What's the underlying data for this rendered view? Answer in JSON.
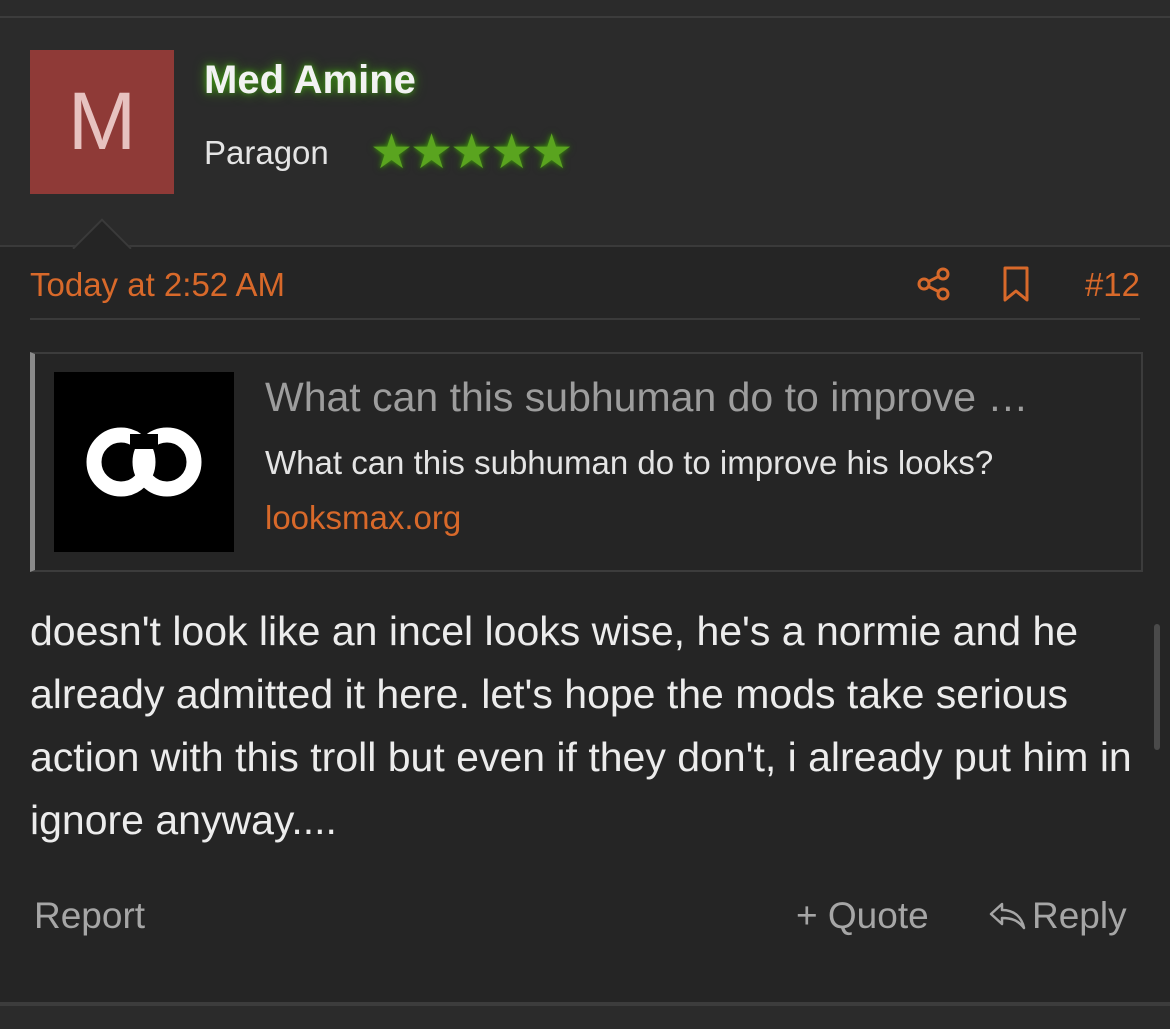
{
  "user": {
    "avatar_letter": "M",
    "avatar_color": "#8f3a37",
    "name": "Med Amine",
    "title": "Paragon",
    "rank_stars": 5,
    "stars": "★★★★★"
  },
  "post": {
    "date": "Today at 2:52 AM",
    "number": "#12",
    "body": "doesn't look like an incel looks wise, he's a normie and he already admitted it here. let's hope the mods take serious action with this troll but even if they don't, i already put him in ignore anyway...."
  },
  "unfurl": {
    "title": "What can this subhuman do to improve …",
    "description": "What can this subhuman do to improve his looks?",
    "domain": "looksmax.org",
    "logo_icon": "looksmax-logo-icon"
  },
  "actions": {
    "share_icon": "share-icon",
    "bookmark_icon": "bookmark-icon",
    "report_label": "Report",
    "quote_label": "+ Quote",
    "reply_label": "Reply",
    "reply_icon": "reply-arrow-icon"
  },
  "colors": {
    "accent": "#d8692a",
    "background": "#252525",
    "header_bg": "#2b2b2b",
    "star_green": "#5aa41f"
  }
}
